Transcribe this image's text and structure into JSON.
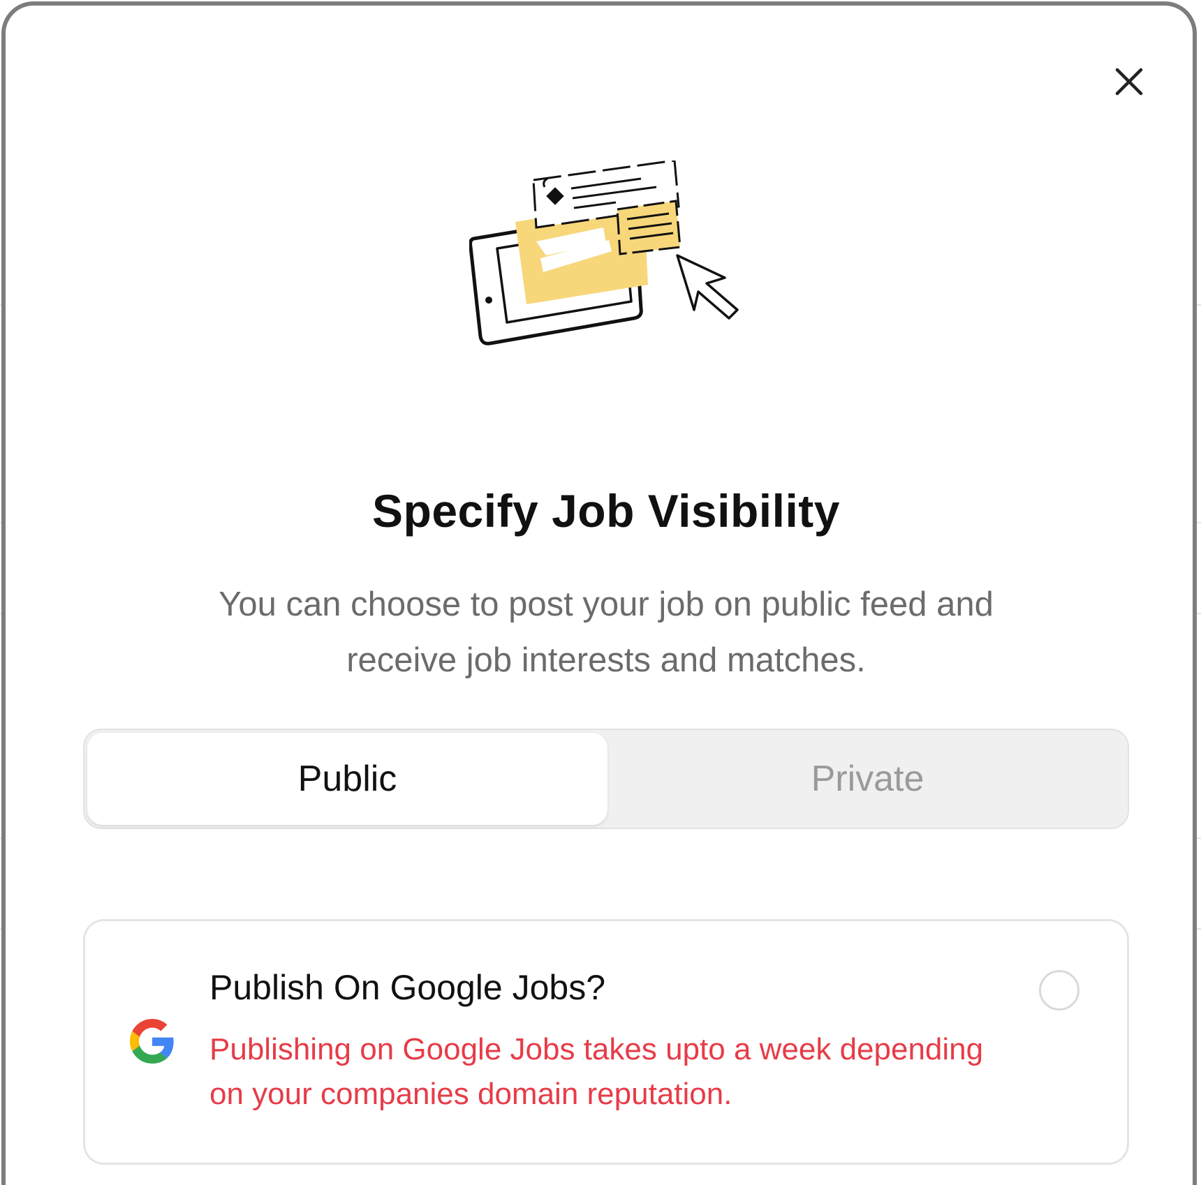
{
  "modal": {
    "title": "Specify Job Visibility",
    "subtitle": "You can choose to post your job on public feed and receive job interests and matches.",
    "close_icon": "close-icon",
    "illustration_icon": "job-post-illustration"
  },
  "visibility_toggle": {
    "options": [
      {
        "label": "Public",
        "selected": true
      },
      {
        "label": "Private",
        "selected": false
      }
    ]
  },
  "google_jobs": {
    "icon": "google-icon",
    "title": "Publish On Google Jobs?",
    "warning": "Publishing on Google Jobs takes upto a week depending on your companies domain reputation.",
    "checked": false
  },
  "colors": {
    "title": "#111111",
    "subtitle": "#6b6b6b",
    "warning": "#e63c48",
    "illustration_accent": "#f7d77a",
    "toggle_bg": "#f0f0f0",
    "toggle_inactive_text": "#9a9a9a"
  }
}
